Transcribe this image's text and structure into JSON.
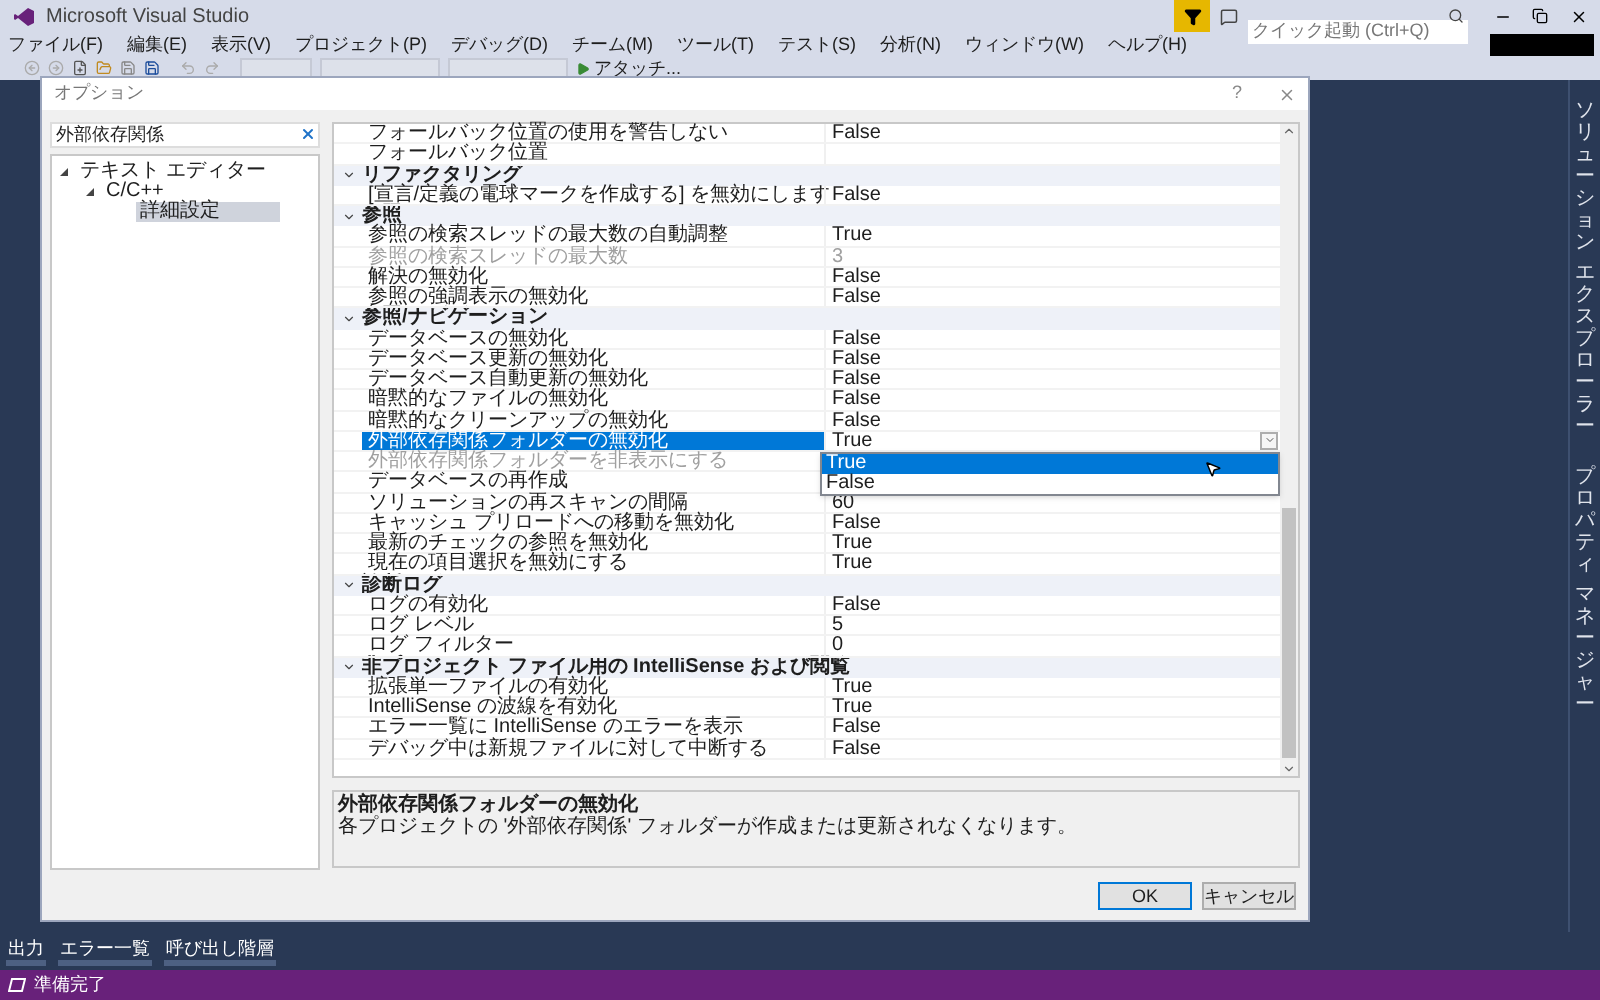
{
  "app": {
    "title": "Microsoft Visual Studio",
    "quick_launch": {
      "placeholder": "クイック起動 (Ctrl+Q)"
    }
  },
  "menu": [
    "ファイル(F)",
    "編集(E)",
    "表示(V)",
    "プロジェクト(P)",
    "デバッグ(D)",
    "チーム(M)",
    "ツール(T)",
    "テスト(S)",
    "分析(N)",
    "ウィンドウ(W)",
    "ヘルプ(H)"
  ],
  "toolbar": {
    "attach": "アタッチ..."
  },
  "side_panels": [
    [
      "ソリューション",
      "エクスプローラー"
    ],
    [
      "プロパティ",
      "マネージャー"
    ]
  ],
  "dialog": {
    "title": "オプション",
    "help": "?",
    "search": {
      "value": "外部依存関係"
    },
    "tree": [
      {
        "label": "テキスト エディター",
        "expanded": true,
        "selected": false,
        "children": [
          {
            "label": "C/C++",
            "expanded": true,
            "selected": false,
            "children": [
              {
                "label": "詳細設定",
                "selected": true
              }
            ]
          }
        ]
      }
    ],
    "grid": {
      "rows": [
        {
          "kind": "property",
          "label": "フォールバック位置の使用を警告しない",
          "value": "False",
          "disabled": false,
          "selected": false
        },
        {
          "kind": "property",
          "label": "フォールバック位置",
          "disabled": false,
          "selected": false
        },
        {
          "kind": "category",
          "label": "リファクタリング",
          "expanded": true
        },
        {
          "kind": "property",
          "label": "[宣言/定義の電球マークを作成する] を無効にします",
          "value": "False",
          "disabled": false,
          "selected": false
        },
        {
          "kind": "category",
          "label": "参照",
          "expanded": true
        },
        {
          "kind": "property",
          "label": "参照の検索スレッドの最大数の自動調整",
          "value": "True",
          "disabled": false,
          "selected": false
        },
        {
          "kind": "property",
          "label": "参照の検索スレッドの最大数",
          "value": "3",
          "disabled": true,
          "selected": false
        },
        {
          "kind": "property",
          "label": "解決の無効化",
          "value": "False",
          "disabled": false,
          "selected": false
        },
        {
          "kind": "property",
          "label": "参照の強調表示の無効化",
          "value": "False",
          "disabled": false,
          "selected": false
        },
        {
          "kind": "category",
          "label": "参照/ナビゲーション",
          "expanded": true
        },
        {
          "kind": "property",
          "label": "データベースの無効化",
          "value": "False",
          "disabled": false,
          "selected": false
        },
        {
          "kind": "property",
          "label": "データベース更新の無効化",
          "value": "False",
          "disabled": false,
          "selected": false
        },
        {
          "kind": "property",
          "label": "データベース自動更新の無効化",
          "value": "False",
          "disabled": false,
          "selected": false
        },
        {
          "kind": "property",
          "label": "暗黙的なファイルの無効化",
          "value": "False",
          "disabled": false,
          "selected": false
        },
        {
          "kind": "property",
          "label": "暗黙的なクリーンアップの無効化",
          "value": "False",
          "disabled": false,
          "selected": false
        },
        {
          "kind": "property",
          "label": "外部依存関係フォルダーの無効化",
          "value": "True",
          "disabled": false,
          "selected": true,
          "dropdown": {
            "options": [
              {
                "label": "True",
                "selected": true
              },
              {
                "label": "False",
                "selected": false
              }
            ]
          }
        },
        {
          "kind": "property",
          "label": "外部依存関係フォルダーを非表示にする",
          "disabled": true,
          "selected": false
        },
        {
          "kind": "property",
          "label": "データベースの再作成",
          "disabled": false,
          "selected": false
        },
        {
          "kind": "property",
          "label": "ソリューションの再スキャンの間隔",
          "value": "60",
          "disabled": false,
          "selected": false
        },
        {
          "kind": "property",
          "label": "キャッシュ プリロードへの移動を無効化",
          "value": "False",
          "disabled": false,
          "selected": false
        },
        {
          "kind": "property",
          "label": "最新のチェックの参照を無効化",
          "value": "True",
          "disabled": false,
          "selected": false
        },
        {
          "kind": "property",
          "label": "現在の項目選択を無効にする",
          "value": "True",
          "disabled": false,
          "selected": false
        },
        {
          "kind": "category",
          "label": "診断ログ",
          "expanded": true
        },
        {
          "kind": "property",
          "label": "ログの有効化",
          "value": "False",
          "disabled": false,
          "selected": false
        },
        {
          "kind": "property",
          "label": "ログ レベル",
          "value": "5",
          "disabled": false,
          "selected": false
        },
        {
          "kind": "property",
          "label": "ログ フィルター",
          "value": "0",
          "disabled": false,
          "selected": false
        },
        {
          "kind": "category",
          "label": "非プロジェクト ファイル用の IntelliSense および閲覧",
          "expanded": true
        },
        {
          "kind": "property",
          "label": "拡張単一ファイルの有効化",
          "value": "True",
          "disabled": false,
          "selected": false
        },
        {
          "kind": "property",
          "label": "IntelliSense の波線を有効化",
          "value": "True",
          "disabled": false,
          "selected": false
        },
        {
          "kind": "property",
          "label": "エラー一覧に IntelliSense のエラーを表示",
          "value": "False",
          "disabled": false,
          "selected": false
        },
        {
          "kind": "property",
          "label": "デバッグ中は新規ファイルに対して中断する",
          "value": "False",
          "disabled": false,
          "selected": false
        }
      ]
    },
    "description": {
      "title": "外部依存関係フォルダーの無効化",
      "text": "各プロジェクトの '外部依存関係' フォルダーが作成または更新されなくなります。"
    },
    "buttons": [
      {
        "label": "OK",
        "default": true
      },
      {
        "label": "キャンセル",
        "default": false
      }
    ]
  },
  "bottom_tabs": [
    "出力",
    "エラー一覧",
    "呼び出し階層"
  ],
  "status_bar": {
    "text": "準備完了"
  }
}
